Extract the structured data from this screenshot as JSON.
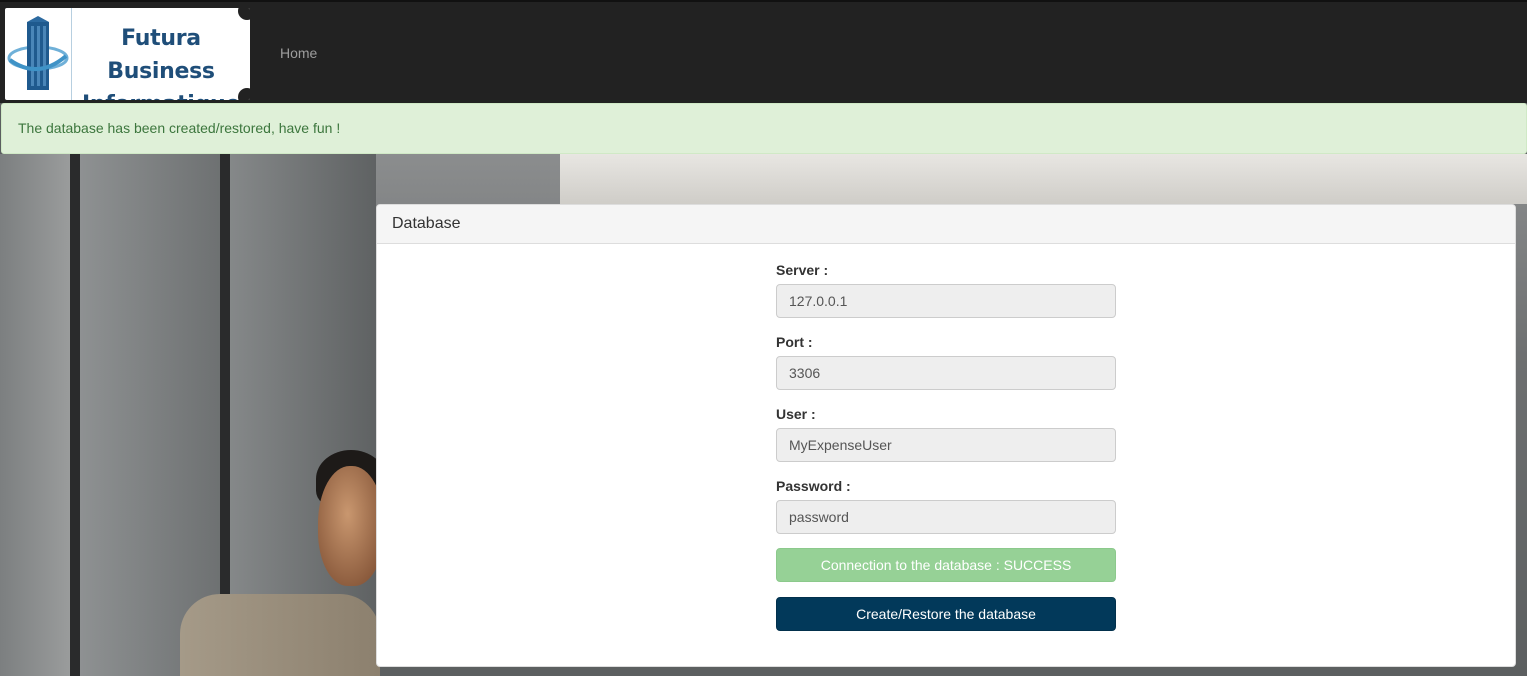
{
  "navbar": {
    "brand_line1": "Futura Business",
    "brand_line2": "Informatique",
    "home_label": "Home"
  },
  "alert": {
    "message": "The database has been created/restored, have fun !"
  },
  "panel": {
    "title": "Database",
    "fields": {
      "server": {
        "label": "Server :",
        "value": "127.0.0.1"
      },
      "port": {
        "label": "Port :",
        "value": "3306"
      },
      "user": {
        "label": "User :",
        "value": "MyExpenseUser"
      },
      "password": {
        "label": "Password :",
        "value": "password"
      }
    },
    "connection_status_label": "Connection to the database : SUCCESS",
    "create_restore_label": "Create/Restore the database"
  },
  "colors": {
    "navbar_bg": "#222222",
    "alert_bg": "#dff0d8",
    "alert_text": "#3c763d",
    "success_button": "#96d196",
    "primary_button": "#02395a",
    "brand_text": "#1f4e79"
  },
  "icons": {
    "logo": "building-swoosh-logo"
  }
}
